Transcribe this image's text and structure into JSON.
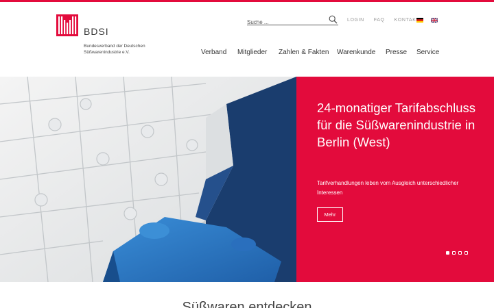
{
  "brand": {
    "name": "BDSI",
    "subtitle_line1": "Bundesverband der Deutschen",
    "subtitle_line2": "Süßwarenindustrie e.V.",
    "accent_color": "#e30b3c"
  },
  "search": {
    "placeholder": "Suche ...",
    "icon": "search-icon"
  },
  "utility_nav": {
    "login": "LOGIN",
    "faq": "FAQ",
    "kontakt": "KONTAKT"
  },
  "languages": [
    {
      "code": "de",
      "icon": "flag-germany-icon"
    },
    {
      "code": "en",
      "icon": "flag-uk-icon"
    }
  ],
  "main_nav": [
    "Verband",
    "Mitglieder",
    "Zahlen & Fakten",
    "Warenkunde",
    "Presse",
    "Service"
  ],
  "hero": {
    "title": "24-monatiger Tarifabschluss für die Süßwarenindustrie in Berlin (West)",
    "description": "Tarifverhandlungen leben vom Ausgleich unterschiedlicher Interessen",
    "button_label": "Mehr",
    "slide_count": 4,
    "active_slide": 1,
    "image_icon": "puzzle-image"
  },
  "section": {
    "heading": "Süßwaren entdecken"
  }
}
